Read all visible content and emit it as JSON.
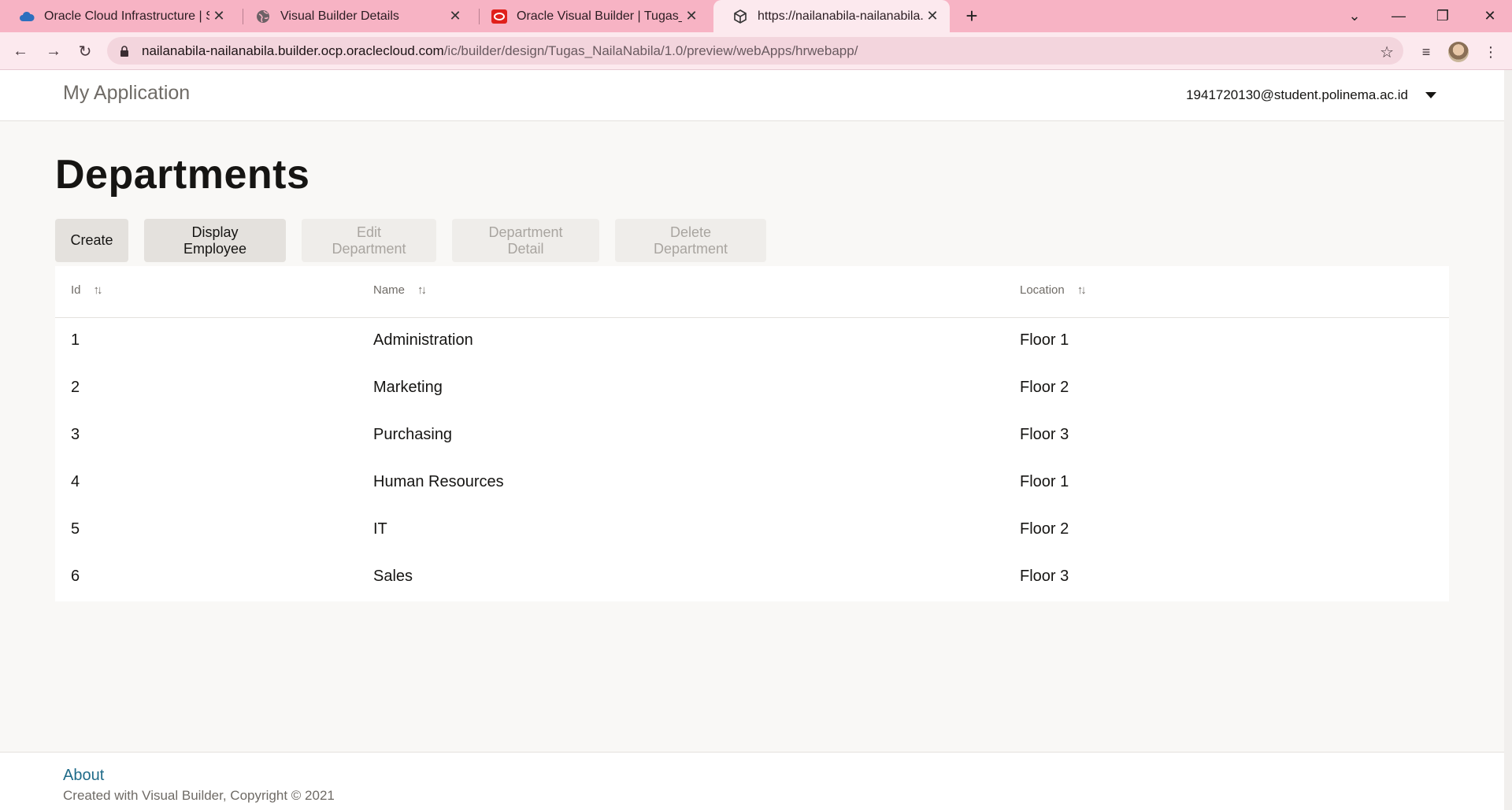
{
  "browser": {
    "tabs": [
      {
        "title": "Oracle Cloud Infrastructure | Sign",
        "icon": "cloud-icon",
        "active": false
      },
      {
        "title": "Visual Builder Details",
        "icon": "globe-icon",
        "active": false
      },
      {
        "title": "Oracle Visual Builder | Tugas_Nai",
        "icon": "oracle-icon",
        "active": false
      },
      {
        "title": "https://nailanabila-nailanabila.bu",
        "icon": "cube-icon",
        "active": true
      }
    ],
    "new_tab": "+",
    "url_host": "nailanabila-nailanabila.builder.ocp.oraclecloud.com",
    "url_path": "/ic/builder/design/Tugas_NailaNabila/1.0/preview/webApps/hrwebapp/"
  },
  "app": {
    "title": "My Application",
    "user": "1941720130@student.polinema.ac.id"
  },
  "page": {
    "title": "Departments",
    "buttons": {
      "create": "Create",
      "display_employee": "Display Employee",
      "edit_department": "Edit Department",
      "department_detail": "Department Detail",
      "delete_department": "Delete Department"
    }
  },
  "table": {
    "columns": {
      "id": "Id",
      "name": "Name",
      "location": "Location"
    },
    "rows": [
      {
        "id": "1",
        "name": "Administration",
        "location": "Floor 1"
      },
      {
        "id": "2",
        "name": "Marketing",
        "location": "Floor 2"
      },
      {
        "id": "3",
        "name": "Purchasing",
        "location": "Floor 3"
      },
      {
        "id": "4",
        "name": "Human Resources",
        "location": "Floor 1"
      },
      {
        "id": "5",
        "name": "IT",
        "location": "Floor 2"
      },
      {
        "id": "6",
        "name": "Sales",
        "location": "Floor 3"
      }
    ]
  },
  "footer": {
    "about": "About",
    "copyright": "Created with Visual Builder, Copyright © 2021"
  },
  "colors": {
    "tabstrip": "#f7b3c4",
    "toolbar": "#fce9ee",
    "link": "#1f6b89"
  }
}
